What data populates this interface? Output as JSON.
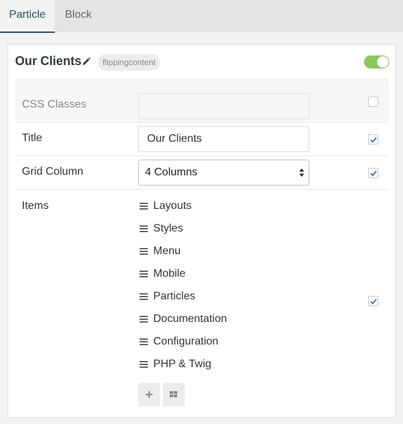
{
  "tabs": [
    {
      "label": "Particle",
      "active": true
    },
    {
      "label": "Block",
      "active": false
    }
  ],
  "panel": {
    "title": "Our Clients",
    "type_badge": "flippingcontent",
    "enabled": true
  },
  "fields": {
    "css_classes": {
      "label": "CSS Classes",
      "value": "",
      "checked": false
    },
    "title": {
      "label": "Title",
      "value": "Our Clients",
      "checked": true
    },
    "grid_column": {
      "label": "Grid Column",
      "selected": "4 Columns",
      "checked": true
    },
    "items": {
      "label": "Items",
      "checked": true,
      "list": [
        "Layouts",
        "Styles",
        "Menu",
        "Mobile",
        "Particles",
        "Documentation",
        "Configuration",
        "PHP & Twig"
      ]
    }
  },
  "colors": {
    "accent": "#2a4d63",
    "toggle_on": "#8cc65a",
    "checkmark": "#3a7fb0"
  }
}
